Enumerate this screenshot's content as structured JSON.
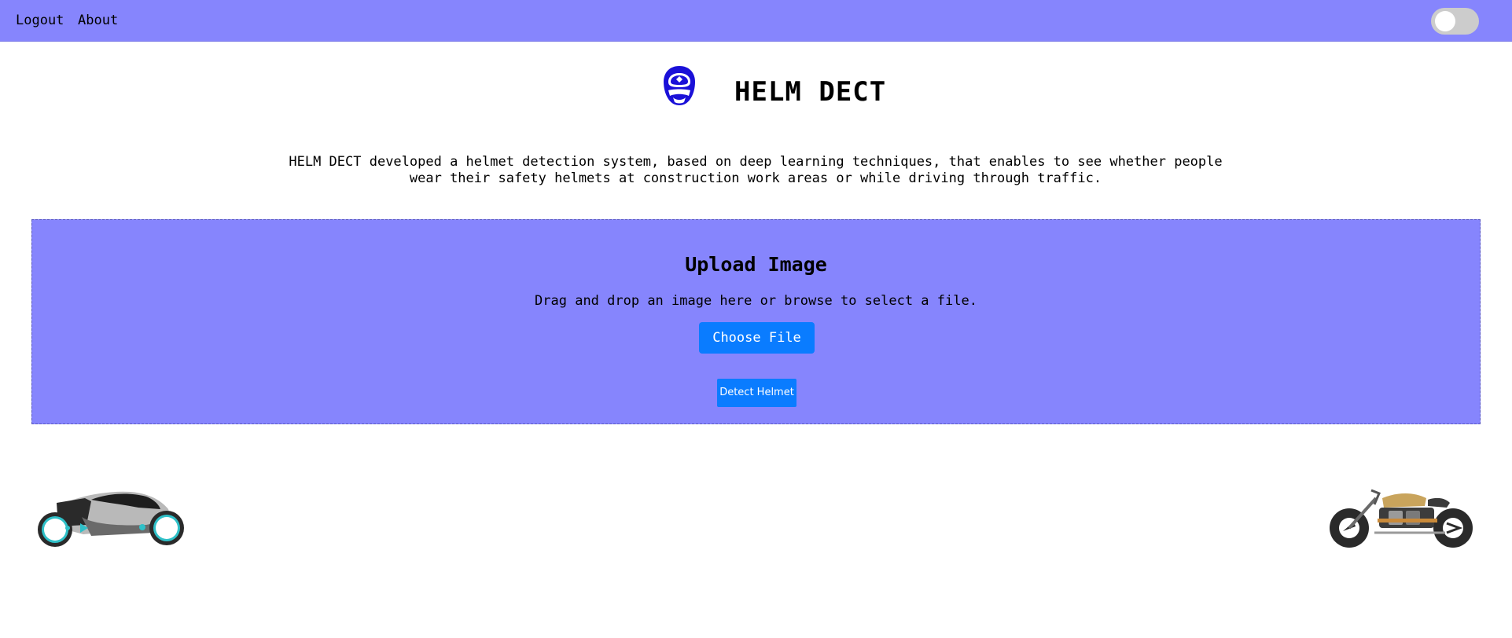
{
  "nav": {
    "logout_label": "Logout",
    "about_label": "About"
  },
  "header": {
    "title": "HELM DECT",
    "logo_icon": "helmet-icon",
    "description": "HELM DECT developed a helmet detection system, based on deep learning techniques, that enables to see whether people wear their safety helmets at construction work areas or while driving through traffic."
  },
  "upload": {
    "title": "Upload Image",
    "hint": "Drag and drop an image here or browse to select a file.",
    "choose_label": "Choose File",
    "detect_label": "Detect Helmet"
  },
  "illustrations": {
    "left": "futuristic-motorbike-icon",
    "right": "chopper-motorbike-icon"
  },
  "colors": {
    "navbar": "#8685fd",
    "upload_area": "#8685fd",
    "button": "#0a7cff",
    "logo": "#1a10d8",
    "toggle_track": "#cccccc"
  }
}
